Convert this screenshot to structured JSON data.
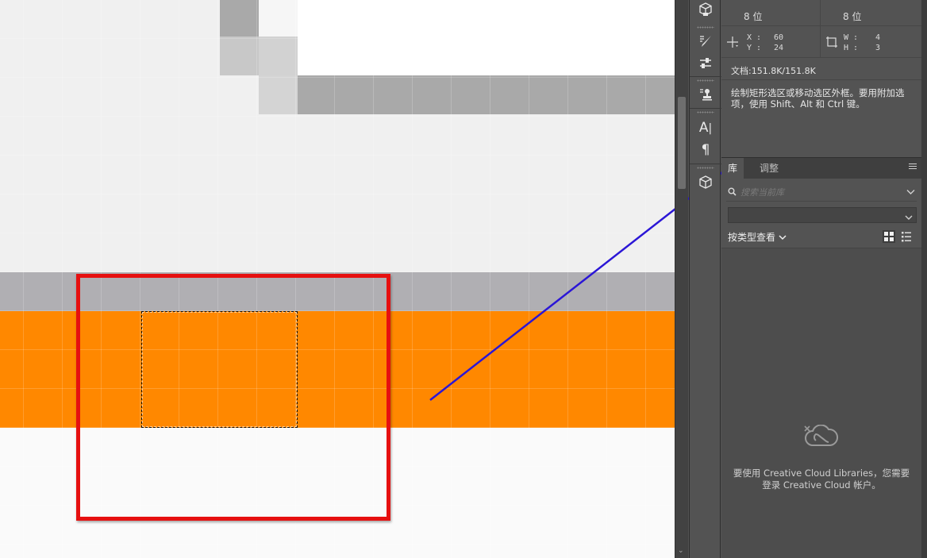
{
  "info_panel": {
    "bit_depth_left": "8 位",
    "bit_depth_right": "8 位",
    "x_label": "X :",
    "x_value": "60",
    "y_label": "Y :",
    "y_value": "24",
    "w_label": "W :",
    "w_value": "4",
    "h_label": "H :",
    "h_value": "3",
    "document_size": "文档:151.8K/151.8K",
    "tool_hint": "绘制矩形选区或移动选区外框。要用附加选项，使用 Shift、Alt 和 Ctrl 键。"
  },
  "library_panel": {
    "tabs": [
      {
        "label": "库",
        "active": true
      },
      {
        "label": "调整",
        "active": false
      }
    ],
    "search_placeholder": "搜索当前库",
    "view_by_type": "按类型查看",
    "cc_message": "要使用 Creative Cloud Libraries，您需要登录 Creative Cloud 帐户。"
  },
  "canvas": {
    "colors": {
      "light_gray": "#efefef",
      "mid_gray": "#a9a9a9",
      "dark_gray": "#b0afb3",
      "orange": "#ff8800",
      "white": "#ffffff",
      "red_annotation": "#e61010",
      "blue_arrow": "#2b16d6"
    }
  },
  "icons": {
    "tool_strip": [
      "3d-cube-icon",
      "brush-presets-icon",
      "sliders-icon",
      "clone-stamp-icon",
      "character-icon",
      "paragraph-icon",
      "3d-box-icon"
    ],
    "info": [
      "crosshair-icon",
      "selection-size-icon"
    ],
    "library": [
      "search-icon",
      "chevron-down-icon",
      "grid-view-icon",
      "list-view-icon",
      "panel-menu-icon",
      "creative-cloud-icon"
    ]
  }
}
